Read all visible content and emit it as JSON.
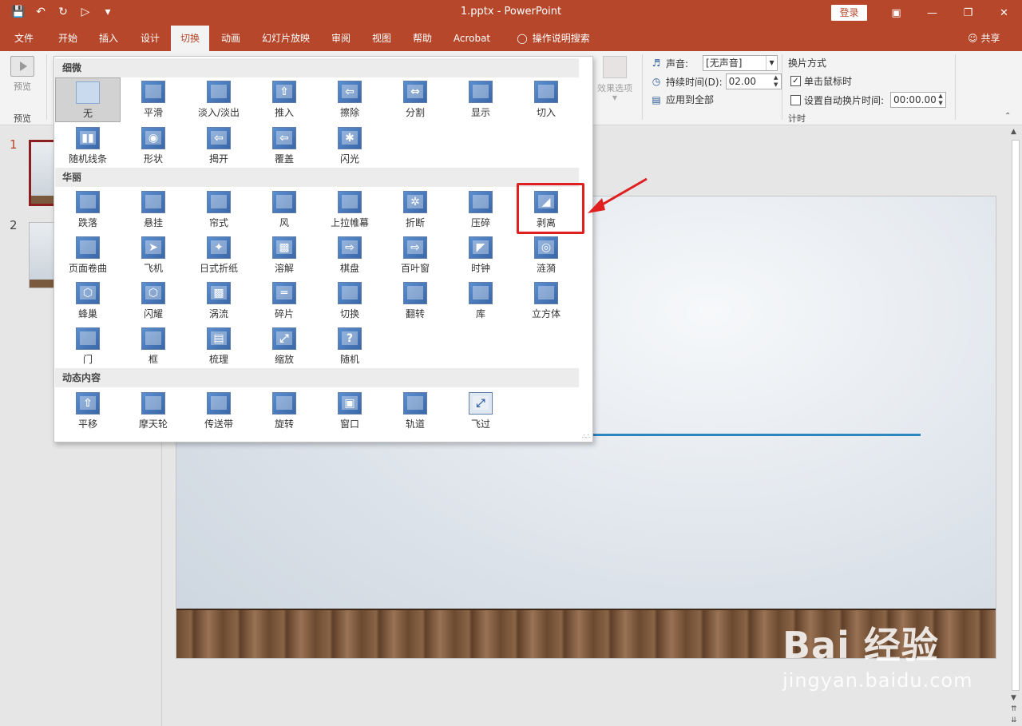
{
  "window": {
    "title": "1.pptx  -  PowerPoint",
    "login_label": "登录",
    "controls": [
      "restore-ribbon-icon",
      "minimize-icon",
      "maximize-icon",
      "close-icon"
    ]
  },
  "qat": {
    "icons": [
      "save-icon",
      "undo-icon",
      "redo-icon",
      "present-icon",
      "customize-icon"
    ]
  },
  "tabs": [
    {
      "label": "文件"
    },
    {
      "label": "开始"
    },
    {
      "label": "插入"
    },
    {
      "label": "设计"
    },
    {
      "label": "切换",
      "active": true
    },
    {
      "label": "动画"
    },
    {
      "label": "幻灯片放映"
    },
    {
      "label": "审阅"
    },
    {
      "label": "视图"
    },
    {
      "label": "帮助"
    },
    {
      "label": "Acrobat"
    },
    {
      "label": "操作说明搜索"
    }
  ],
  "share_label": "共享",
  "ribbon": {
    "preview_label": "预览",
    "preview_group_label": "预览",
    "effect_options_label": "效果选项",
    "timing": {
      "sound_label": "声音:",
      "sound_value": "[无声音]",
      "duration_label": "持续时间(D):",
      "duration_value": "02.00",
      "apply_all_label": "应用到全部",
      "advance_label": "换片方式",
      "on_click_label": "单击鼠标时",
      "on_click_checked": true,
      "after_label": "设置自动换片时间:",
      "after_checked": false,
      "after_value": "00:00.00",
      "group_label": "计时"
    }
  },
  "gallery": {
    "sections": [
      {
        "title": "细微",
        "items": [
          "无",
          "平滑",
          "淡入/淡出",
          "推入",
          "擦除",
          "分割",
          "显示",
          "切入",
          "随机线条",
          "形状",
          "揭开",
          "覆盖",
          "闪光"
        ]
      },
      {
        "title": "华丽",
        "items": [
          "跌落",
          "悬挂",
          "帘式",
          "风",
          "上拉帷幕",
          "折断",
          "压碎",
          "剥离",
          "页面卷曲",
          "飞机",
          "日式折纸",
          "溶解",
          "棋盘",
          "百叶窗",
          "时钟",
          "涟漪",
          "蜂巢",
          "闪耀",
          "涡流",
          "碎片",
          "切换",
          "翻转",
          "库",
          "立方体",
          "门",
          "框",
          "梳理",
          "缩放",
          "随机"
        ]
      },
      {
        "title": "动态内容",
        "items": [
          "平移",
          "摩天轮",
          "传送带",
          "旋转",
          "窗口",
          "轨道",
          "飞过"
        ]
      }
    ],
    "selected": "无",
    "highlighted": "剥离"
  },
  "slides": [
    {
      "number": "1",
      "selected": true
    },
    {
      "number": "2",
      "selected": false
    }
  ],
  "watermark": {
    "logo": "Bai 经验",
    "url": "jingyan.baidu.com"
  },
  "colors": {
    "accent": "#b7472a",
    "highlight": "#e02020",
    "slide_line": "#2e86c1"
  }
}
